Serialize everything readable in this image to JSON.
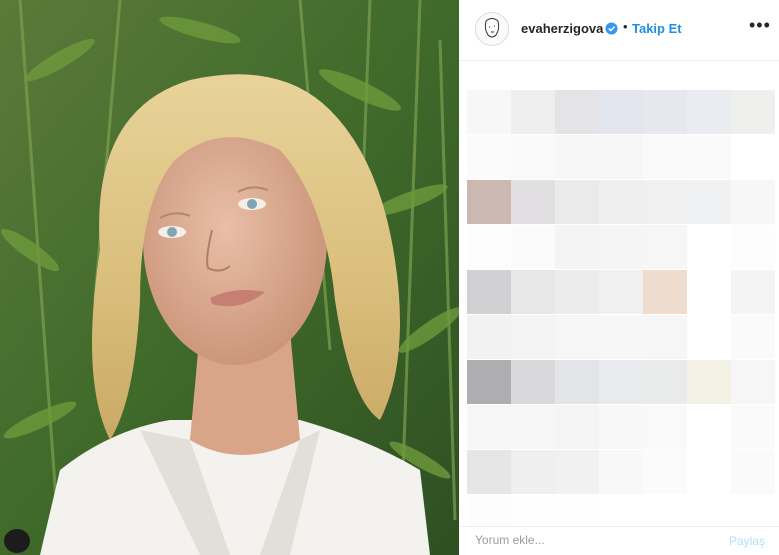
{
  "post": {
    "username": "evaherzigova",
    "verified": true,
    "separator": "•",
    "follow_label": "Takip Et",
    "more_label": "•••"
  },
  "comment": {
    "placeholder": "Yorum ekle...",
    "share_label": "Paylaş"
  },
  "icons": {
    "verified": "verified-badge-icon",
    "more": "more-options-icon",
    "avatar": "profile-avatar"
  },
  "colors": {
    "follow": "#1f8fe0",
    "verified": "#3897f0",
    "share_disabled": "#b2dffc"
  },
  "mosaic_colors": [
    [
      "#f7f7f7",
      "#efefef",
      "#e3e3e8",
      "#e3e6ee",
      "#e7e8ee",
      "#e9ecf1",
      "#efefed"
    ],
    [
      "#fbfbfb",
      "#f9f9f9",
      "#f7f7f7",
      "#f6f6f6",
      "#f9f9f9",
      "#fafafa",
      "#ffffff"
    ],
    [
      "#cbb9b1",
      "#e2dfe2",
      "#eaeaea",
      "#efefef",
      "#f0f0f0",
      "#f0f1f2",
      "#f7f7f7"
    ],
    [
      "#fdfdfd",
      "#fbfbfb",
      "#f4f4f4",
      "#f5f5f5",
      "#f6f6f6",
      "#ffffff",
      "#fdfdfd"
    ],
    [
      "#d1d1d3",
      "#e7e7e7",
      "#ececec",
      "#f0f0f0",
      "#eeddcf",
      "#ffffff",
      "#f4f4f4"
    ],
    [
      "#f2f2f2",
      "#f4f4f4",
      "#f6f6f6",
      "#f7f7f7",
      "#f6f6f6",
      "#ffffff",
      "#fafafa"
    ],
    [
      "#aeaeb0",
      "#d9d9db",
      "#e3e4e8",
      "#e8eaee",
      "#e9eaea",
      "#f3f1e3",
      "#f6f6f6"
    ],
    [
      "#f6f6f6",
      "#f7f7f7",
      "#f5f5f5",
      "#f8f8f8",
      "#f9f9f9",
      "#ffffff",
      "#fafafa"
    ],
    [
      "#e6e6e6",
      "#efefef",
      "#f1f1f1",
      "#f8f8f8",
      "#fbfbfb",
      "#ffffff",
      "#fafafa"
    ],
    [
      "#fdfdfd",
      "#fefefe",
      "#fefefe",
      "#ffffff",
      "#ffffff",
      "#ffffff",
      "#ffffff"
    ]
  ]
}
